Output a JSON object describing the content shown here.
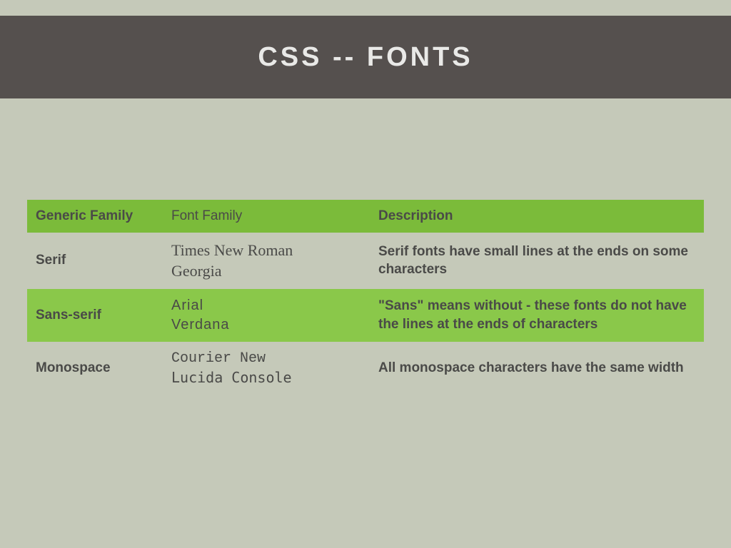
{
  "title": "CSS -- Fonts",
  "headers": {
    "generic": "Generic family",
    "font": "Font family",
    "desc": "Description"
  },
  "rows": [
    {
      "generic": "Serif",
      "font1": "Times New Roman",
      "font2": "Georgia",
      "desc": "Serif fonts have small lines at the ends on some characters"
    },
    {
      "generic": "Sans-serif",
      "font1": "Arial",
      "font2": "Verdana",
      "desc": "\"Sans\" means without - these fonts do not have the lines at the ends of characters"
    },
    {
      "generic": "Monospace",
      "font1": "Courier New",
      "font2": "Lucida Console",
      "desc": "All monospace characters have the same width"
    }
  ]
}
